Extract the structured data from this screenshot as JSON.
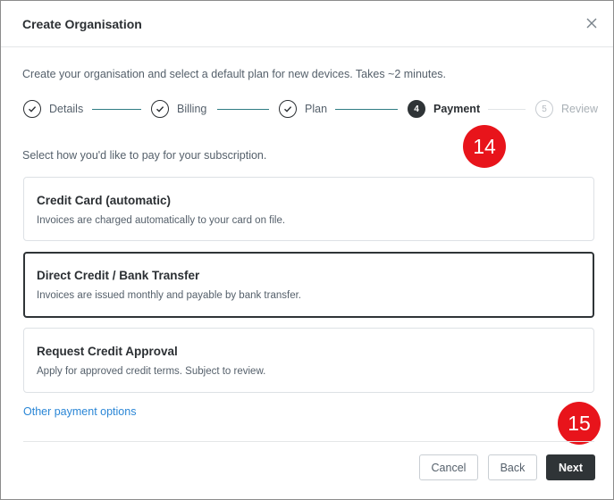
{
  "dialog": {
    "title": "Create Organisation",
    "close_icon": "close-icon",
    "intro": "Create your organisation and select a default plan for new devices. Takes ~2 minutes."
  },
  "stepper": {
    "steps": [
      {
        "number": "1",
        "label": "Details",
        "state": "done"
      },
      {
        "number": "2",
        "label": "Billing",
        "state": "done"
      },
      {
        "number": "3",
        "label": "Plan",
        "state": "done"
      },
      {
        "number": "4",
        "label": "Payment",
        "state": "active"
      },
      {
        "number": "5",
        "label": "Review",
        "state": "pending"
      }
    ],
    "colors": {
      "complete_line": "#2f7d84",
      "pending_line": "#e1e4e7",
      "active": "#2f3437"
    }
  },
  "annotations": {
    "badge_top": "14",
    "badge_bottom": "15",
    "color": "#e8141b"
  },
  "payment": {
    "prompt": "Select how you'd like to pay for your subscription.",
    "options": [
      {
        "title": "Credit Card (automatic)",
        "description": "Invoices are charged automatically to your card on file.",
        "selected": false
      },
      {
        "title": "Direct Credit / Bank Transfer",
        "description": "Invoices are issued monthly and payable by bank transfer.",
        "selected": true
      },
      {
        "title": "Request Credit Approval",
        "description": "Apply for approved credit terms. Subject to review.",
        "selected": false
      }
    ],
    "other_link": "Other payment options"
  },
  "footer": {
    "cancel_label": "Cancel",
    "back_label": "Back",
    "next_label": "Next"
  }
}
